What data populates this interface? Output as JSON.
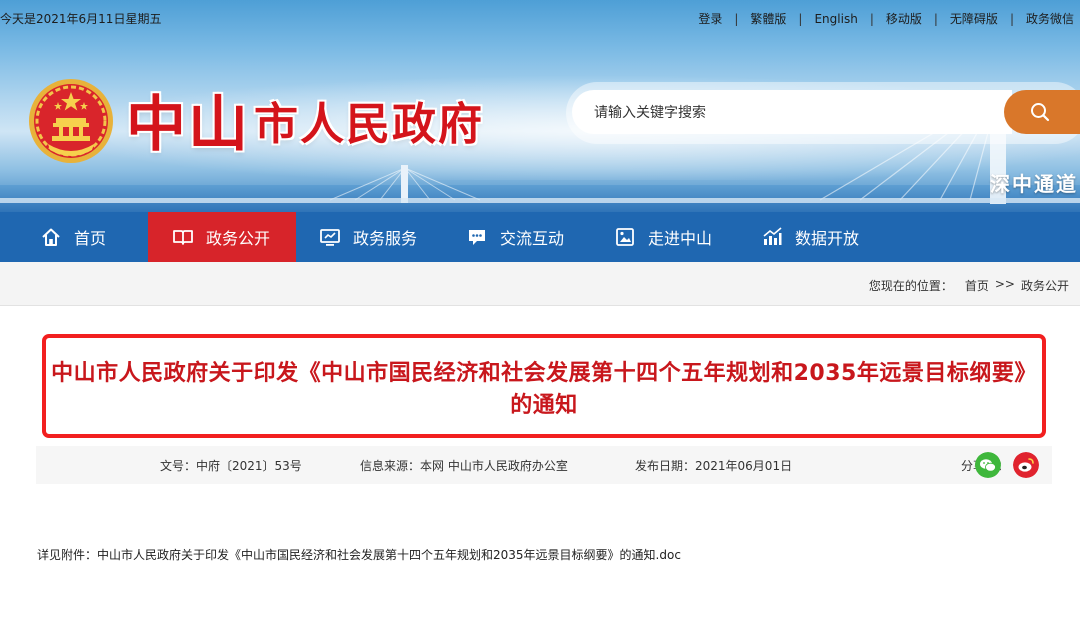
{
  "topbar": {
    "date": "今天是2021年6月11日星期五",
    "links": [
      "登录",
      "繁體版",
      "English",
      "移动版",
      "无障碍版",
      "政务微信"
    ]
  },
  "header": {
    "title_first": "中山",
    "title_rest": "市人民政府",
    "emblem_icon": "national-emblem-icon",
    "banner_caption": "深中通道"
  },
  "search": {
    "placeholder": "请输入关键字搜索",
    "button_icon": "search-icon",
    "button_color": "#d9772a"
  },
  "nav": {
    "items": [
      {
        "label": "首页",
        "icon": "home-icon"
      },
      {
        "label": "政务公开",
        "icon": "book-icon",
        "active": true
      },
      {
        "label": "政务服务",
        "icon": "monitor-icon"
      },
      {
        "label": "交流互动",
        "icon": "chat-icon"
      },
      {
        "label": "走进中山",
        "icon": "picture-icon"
      },
      {
        "label": "数据开放",
        "icon": "bar-chart-icon"
      }
    ],
    "bg_color": "#1f67b1",
    "active_color": "#d7242a"
  },
  "breadcrumb": {
    "prefix": "您现在的位置：",
    "items": [
      "首页",
      "政务公开"
    ],
    "separator": ">>"
  },
  "article": {
    "title": "中山市人民政府关于印发《中山市国民经济和社会发展第十四个五年规划和2035年远景目标纲要》的通知",
    "title_color": "#c8171c",
    "highlight_color": "#f21f1f",
    "doc_number": "文号：中府〔2021〕53号",
    "source": "信息来源：本网 中山市人民政府办公室",
    "date": "发布日期：2021年06月01日",
    "share_label": "分享到：",
    "share_icons": [
      "wechat-icon",
      "weibo-icon"
    ],
    "attachment_label": "详见附件：",
    "attachment_name": "中山市人民政府关于印发《中山市国民经济和社会发展第十四个五年规划和2035年远景目标纲要》的通知.doc"
  }
}
